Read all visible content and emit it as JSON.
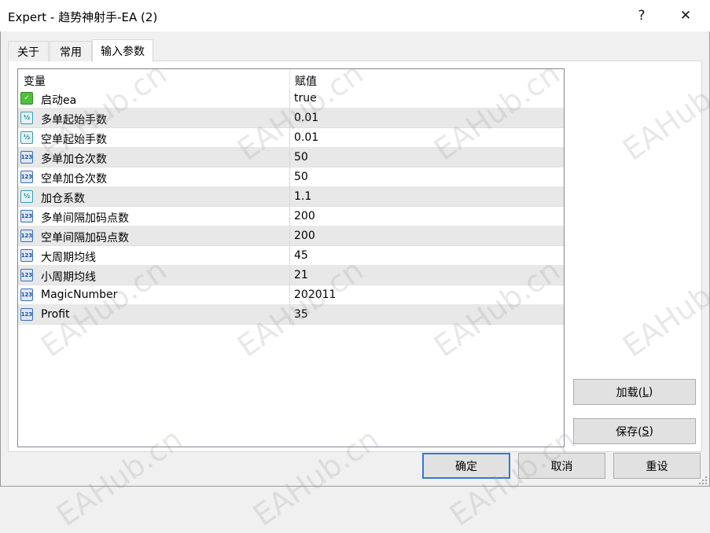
{
  "window": {
    "title": "Expert - 趋势神射手-EA (2)",
    "help_label": "?",
    "close_label": "✕"
  },
  "tabs": [
    {
      "label": "关于"
    },
    {
      "label": "常用"
    },
    {
      "label": "输入参数"
    }
  ],
  "grid": {
    "columns": [
      "变量",
      "赋值"
    ],
    "rows": [
      {
        "name": "启动ea",
        "value": "true",
        "icon": "bool-icon"
      },
      {
        "name": "多单起始手数",
        "value": "0.01",
        "icon": "fraction-icon"
      },
      {
        "name": "空单起始手数",
        "value": "0.01",
        "icon": "fraction-icon"
      },
      {
        "name": "多单加仓次数",
        "value": "50",
        "icon": "integer-icon"
      },
      {
        "name": "空单加仓次数",
        "value": "50",
        "icon": "integer-icon"
      },
      {
        "name": "加仓系数",
        "value": "1.1",
        "icon": "fraction-icon"
      },
      {
        "name": "多单间隔加码点数",
        "value": "200",
        "icon": "integer-icon"
      },
      {
        "name": "空单间隔加码点数",
        "value": "200",
        "icon": "integer-icon"
      },
      {
        "name": "大周期均线",
        "value": "45",
        "icon": "integer-icon"
      },
      {
        "name": "小周期均线",
        "value": "21",
        "icon": "integer-icon"
      },
      {
        "name": "MagicNumber",
        "value": "202011",
        "icon": "integer-icon"
      },
      {
        "name": "Profit",
        "value": "35",
        "icon": "integer-icon"
      }
    ]
  },
  "icons": {
    "integer_glyph": "123",
    "fraction_glyph": "½",
    "bool_glyph": "✓"
  },
  "buttons": {
    "load_label": "加载(",
    "load_key": "L",
    "load_suffix": ")",
    "save_label": "保存(",
    "save_key": "S",
    "save_suffix": ")",
    "ok_label": "确定",
    "cancel_label": "取消",
    "reset_label": "重设"
  },
  "watermark": {
    "text": "EAHub.cn"
  }
}
